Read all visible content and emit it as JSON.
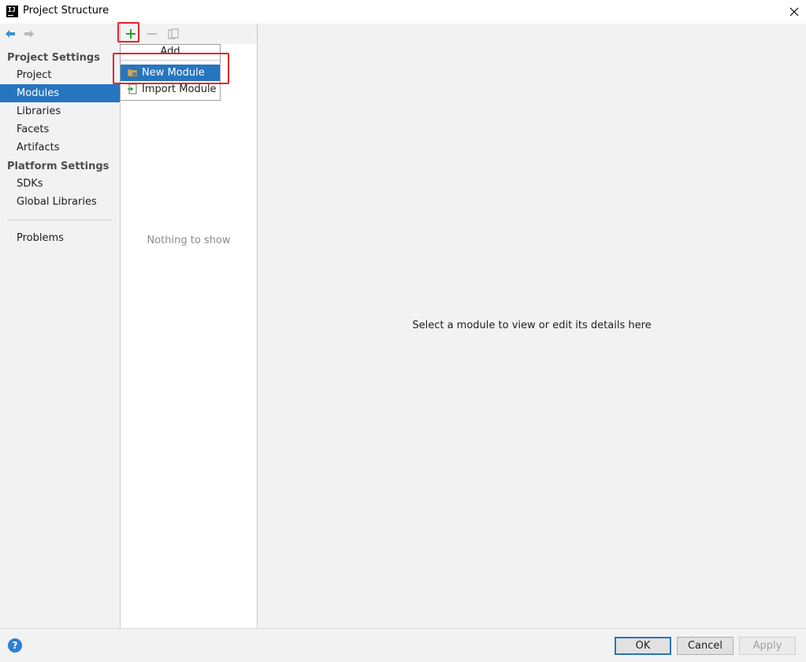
{
  "window": {
    "title": "Project Structure",
    "logo_text": "IJ"
  },
  "sidebar": {
    "sections": [
      {
        "header": "Project Settings",
        "items": [
          "Project",
          "Modules",
          "Libraries",
          "Facets",
          "Artifacts"
        ]
      },
      {
        "header": "Platform Settings",
        "items": [
          "SDKs",
          "Global Libraries"
        ]
      }
    ],
    "problems_label": "Problems",
    "selected_item": "Modules"
  },
  "modules_panel": {
    "empty_text": "Nothing to show"
  },
  "add_popup": {
    "title": "Add",
    "items": [
      {
        "label": "New Module",
        "icon": "folder-module-icon",
        "selected": true
      },
      {
        "label": "Import Module",
        "icon": "import-module-icon",
        "selected": false
      }
    ]
  },
  "detail": {
    "placeholder": "Select a module to view or edit its details here"
  },
  "buttons": {
    "ok": "OK",
    "cancel": "Cancel",
    "apply": "Apply",
    "help": "?"
  },
  "colors": {
    "selection": "#2675bf",
    "highlight": "#e8222a",
    "add_green": "#2e9e3a"
  }
}
